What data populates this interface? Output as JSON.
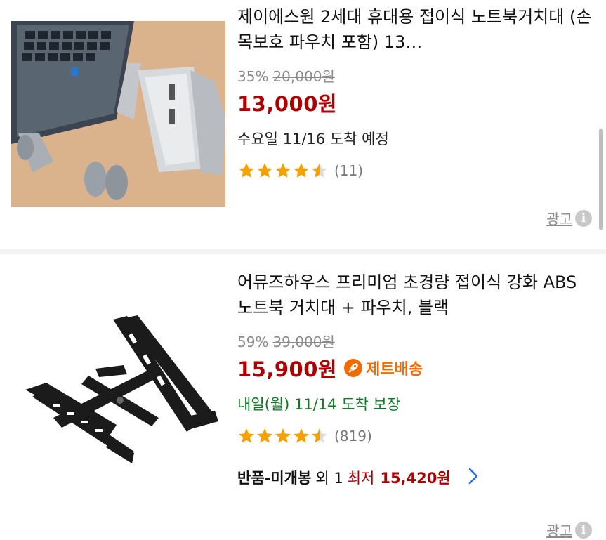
{
  "products": [
    {
      "title": "제이에스원 2세대 휴대용 접이식 노트북거치대 (손목보호 파우치 포함) 13…",
      "discount": "35%",
      "original_price": "20,000원",
      "price": "13,000원",
      "delivery": "수요일 11/16 도착 예정",
      "rating": 4.5,
      "review_count": "(11)",
      "ad_label": "광고"
    },
    {
      "title": "어뮤즈하우스 프리미엄 초경량 접이식 강화 ABS 노트북 거치대 + 파우치, 블랙",
      "discount": "59%",
      "original_price": "39,000원",
      "price": "15,900원",
      "rocket_label": "제트배송",
      "delivery": "내일(월) 11/14 도착 보장",
      "rating": 4.5,
      "review_count": "(819)",
      "lowest": {
        "condition": "반품-미개봉",
        "extra": "외 1",
        "best_label": "최저",
        "best_price": "15,420원"
      }
    }
  ],
  "ad_label_bottom": "광고",
  "colors": {
    "price": "#ae0000",
    "rocket": "#f56a00",
    "star": "#f5a200",
    "delivery_guarantee": "#0a7d20",
    "chevron": "#2f6fe0"
  }
}
